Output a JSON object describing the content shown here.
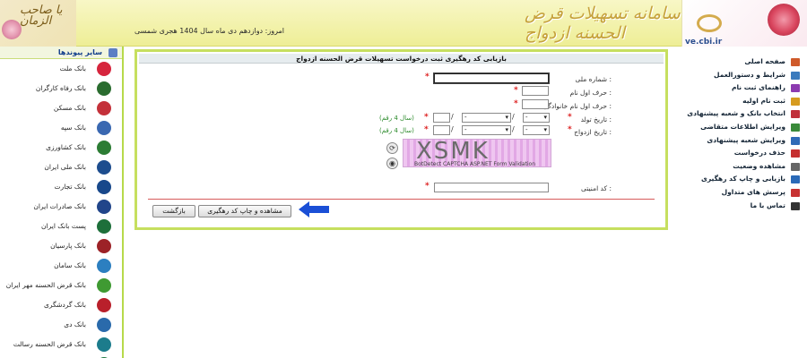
{
  "header": {
    "date_text": "امروز: دوازدهم دی ماه سال 1404 هجری شمسی",
    "site_title": "سامانه تسهیلات قرض الحسنه ازدواج",
    "site_url": "ve.cbi.ir",
    "left_logo_text": "یا صاحب الزمان"
  },
  "left_sidebar": {
    "title": "سایر پیوندها",
    "banks": [
      {
        "label": "بانک ملت",
        "color": "#d6253d"
      },
      {
        "label": "بانک رفاه کارگران",
        "color": "#2a6c2f"
      },
      {
        "label": "بانک مسکن",
        "color": "#c4313a"
      },
      {
        "label": "بانک سپه",
        "color": "#3a68b1"
      },
      {
        "label": "بانک کشاورزی",
        "color": "#2c7c34"
      },
      {
        "label": "بانک ملی ایران",
        "color": "#1d4d8e"
      },
      {
        "label": "بانک تجارت",
        "color": "#18488b"
      },
      {
        "label": "بانک صادرات ایران",
        "color": "#21458a"
      },
      {
        "label": "پست بانک ایران",
        "color": "#1d6f3a"
      },
      {
        "label": "بانک پارسیان",
        "color": "#9c2227"
      },
      {
        "label": "بانک سامان",
        "color": "#2c7fc0"
      },
      {
        "label": "بانک قرض الحسنه مهر ایران",
        "color": "#3f9a32"
      },
      {
        "label": "بانک گردشگری",
        "color": "#b9202b"
      },
      {
        "label": "بانک دی",
        "color": "#2a6aab"
      },
      {
        "label": "بانک قرض الحسنه رسالت",
        "color": "#1c7c8c"
      },
      {
        "label": "بانک کارآفرین",
        "color": "#1f7a40"
      }
    ]
  },
  "form": {
    "title": "بازیابی کد رهگیری ثبت درخواست تسهیلات قرض الحسنه ازدواج",
    "national_id_label": "شماره ملی :",
    "first_letter_name_label": "حرف اول نام :",
    "first_letter_family_label": "حرف اول نام خانوادگی :",
    "birth_date_label": "تاریخ تولد :",
    "marriage_date_label": "تاریخ ازدواج :",
    "year_hint": "(سال 4 رقم)",
    "day_placeholder": "-",
    "month_placeholder": "-",
    "captcha_text": "XSMK",
    "captcha_note": "BotDetect CAPTCHA ASP.NET Form Validation",
    "security_code_label": "کد امنیتی :",
    "view_print_button": "مشاهده و چاپ کد رهگیری",
    "back_button": "بازگشت"
  },
  "right_sidebar": {
    "items": [
      {
        "label": "صفحه اصلی",
        "color": "#cf5a2a"
      },
      {
        "label": "شرایط و دستورالعمل",
        "color": "#3b7bbd"
      },
      {
        "label": "راهنمای ثبت نام",
        "color": "#8c3ab0"
      },
      {
        "label": "ثبت نام اولیه",
        "color": "#d69b1f"
      },
      {
        "label": "انتخاب بانک و شعبه پیشنهادی",
        "color": "#c0303a"
      },
      {
        "label": "ویرایش اطلاعات متقاضی",
        "color": "#3a8a3a"
      },
      {
        "label": "ویرایش شعبه پیشنهادی",
        "color": "#2f6bb7"
      },
      {
        "label": "حذف درخواست",
        "color": "#c53030"
      },
      {
        "label": "مشاهده وضعیت",
        "color": "#666666"
      },
      {
        "label": "بازیابی و چاپ کد رهگیری",
        "color": "#2a6ab8"
      },
      {
        "label": "پرسش های متداول",
        "color": "#c73232"
      },
      {
        "label": "تماس با ما",
        "color": "#333333"
      }
    ]
  }
}
